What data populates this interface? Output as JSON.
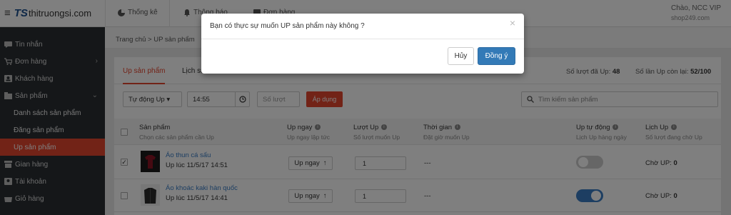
{
  "brand": {
    "logo_mark": "TS",
    "logo_text": "thitruongsi.com"
  },
  "topbar": {
    "items": [
      {
        "label": "Thống kê"
      },
      {
        "label": "Thông báo"
      },
      {
        "label": "Đơn hàng"
      }
    ],
    "greeting": "Chào, NCC VIP",
    "site": "shop249.com"
  },
  "sidebar": {
    "items": [
      {
        "label": "Tin nhắn",
        "icon": "message-icon"
      },
      {
        "label": "Đơn hàng",
        "icon": "cart-icon"
      },
      {
        "label": "Khách hàng",
        "icon": "customer-icon"
      },
      {
        "label": "Sản phẩm",
        "icon": "box-icon"
      },
      {
        "label": "Gian hàng",
        "icon": "store-icon"
      },
      {
        "label": "Tài khoản",
        "icon": "user-icon"
      },
      {
        "label": "Giỏ hàng",
        "icon": "basket-icon"
      }
    ],
    "subitems": [
      {
        "label": "Danh sách sản phẩm"
      },
      {
        "label": "Đăng sản phẩm"
      },
      {
        "label": "Up sản phẩm"
      }
    ]
  },
  "breadcrumb": "Trang chủ > UP sản phẩm",
  "tabs": [
    {
      "label": "Up sản phẩm"
    },
    {
      "label": "Lịch sử"
    }
  ],
  "stats": {
    "used_label": "Số lượt đã Up:",
    "used_value": "48",
    "remaining_label": "Số lần Up còn lại:",
    "remaining_value": "52/100"
  },
  "filters": {
    "mode": "Tự động Up ▾",
    "time": "14:55",
    "count_placeholder": "Số lượt",
    "apply": "Áp dụng",
    "search_placeholder": "Tìm kiếm sản phẩm"
  },
  "columns": [
    {
      "title": "Sản phẩm",
      "sub": "Chọn các sản phẩm cần Up"
    },
    {
      "title": "Up ngay",
      "sub": "Up ngay lập tức"
    },
    {
      "title": "Lượt Up",
      "sub": "Số lượt muốn Up"
    },
    {
      "title": "Thời gian",
      "sub": "Đặt giờ muốn Up"
    },
    {
      "title": "Up tự động",
      "sub": "Lịch Up hàng ngày"
    },
    {
      "title": "Lịch Up",
      "sub": "Số lượt đang chờ Up"
    }
  ],
  "rows": [
    {
      "name": "Áo thun cá sấu",
      "time": "Up lúc 11/5/17 14:51",
      "up_now": "Up ngay",
      "qty": "1",
      "schedule": "---",
      "auto": false,
      "wait_label": "Chờ UP:",
      "wait_value": "0",
      "checked": true
    },
    {
      "name": "Áo khoác kaki hàn quốc",
      "time": "Up lúc 11/5/17 14:41",
      "up_now": "Up ngay",
      "qty": "1",
      "schedule": "---",
      "auto": true,
      "wait_label": "Chờ UP:",
      "wait_value": "0",
      "checked": false
    }
  ],
  "modal": {
    "message": "Bạn có thực sự muốn UP sản phẩm này không ?",
    "close": "×",
    "cancel": "Hủy",
    "confirm": "Đồng ý"
  },
  "colors": {
    "accent": "#e5462f",
    "primary": "#337ab7",
    "toggle_on": "#3b7dc4",
    "toggle_off": "#cccccc"
  }
}
